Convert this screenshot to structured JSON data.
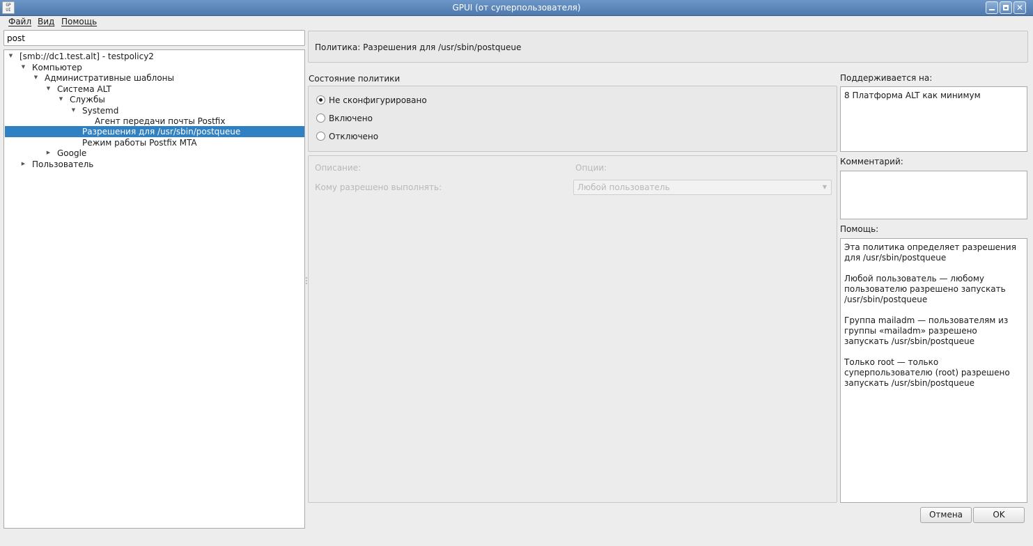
{
  "window": {
    "title": "GPUI (от суперпользователя)",
    "icon_text": "GP UI"
  },
  "menu": {
    "file": "Файл",
    "view": "Вид",
    "help": "Помощь"
  },
  "search": {
    "value": "post"
  },
  "tree": {
    "rows": [
      {
        "label": "[smb://dc1.test.alt] - testpolicy2",
        "expanded": true
      },
      {
        "label": "Компьютер",
        "expanded": true
      },
      {
        "label": "Административные шаблоны",
        "expanded": true
      },
      {
        "label": "Система ALT",
        "expanded": true
      },
      {
        "label": "Службы",
        "expanded": true
      },
      {
        "label": "Systemd",
        "expanded": true
      },
      {
        "label": "Агент передачи почты Postfix"
      },
      {
        "label": "Разрешения для /usr/sbin/postqueue",
        "selected": true
      },
      {
        "label": "Режим работы Postfix MTA"
      },
      {
        "label": "Google",
        "expanded": false
      },
      {
        "label": "Пользователь",
        "expanded": false
      }
    ]
  },
  "policy": {
    "title": "Политика: Разрешения для /usr/sbin/postqueue",
    "state_label": "Состояние политики",
    "states": [
      "Не сконфигурировано",
      "Включено",
      "Отключено"
    ],
    "selected_state": "Не сконфигурировано",
    "description_label": "Описание:",
    "options_label": "Опции:",
    "who_can_run_label": "Кому разрешено выполнять:",
    "who_can_run_value": "Любой пользователь"
  },
  "side": {
    "supported_label": "Поддерживается на:",
    "supported_value": "8 Платформа ALT как минимум",
    "comment_label": "Комментарий:",
    "comment_value": "",
    "help_label": "Помощь:",
    "help_paragraphs": [
      "Эта политика определяет разрешения для /usr/sbin/postqueue",
      "Любой пользователь — любому пользователю разрешено запускать /usr/sbin/postqueue",
      "Группа mailadm — пользователям из группы «mailadm» разрешено запускать /usr/sbin/postqueue",
      "Только root — только суперпользователю (root) разрешено запускать /usr/sbin/postqueue"
    ]
  },
  "buttons": {
    "cancel": "Отмена",
    "ok": "OK"
  },
  "colors": {
    "selection": "#3081c3",
    "titlebar": "#5a84b8"
  }
}
